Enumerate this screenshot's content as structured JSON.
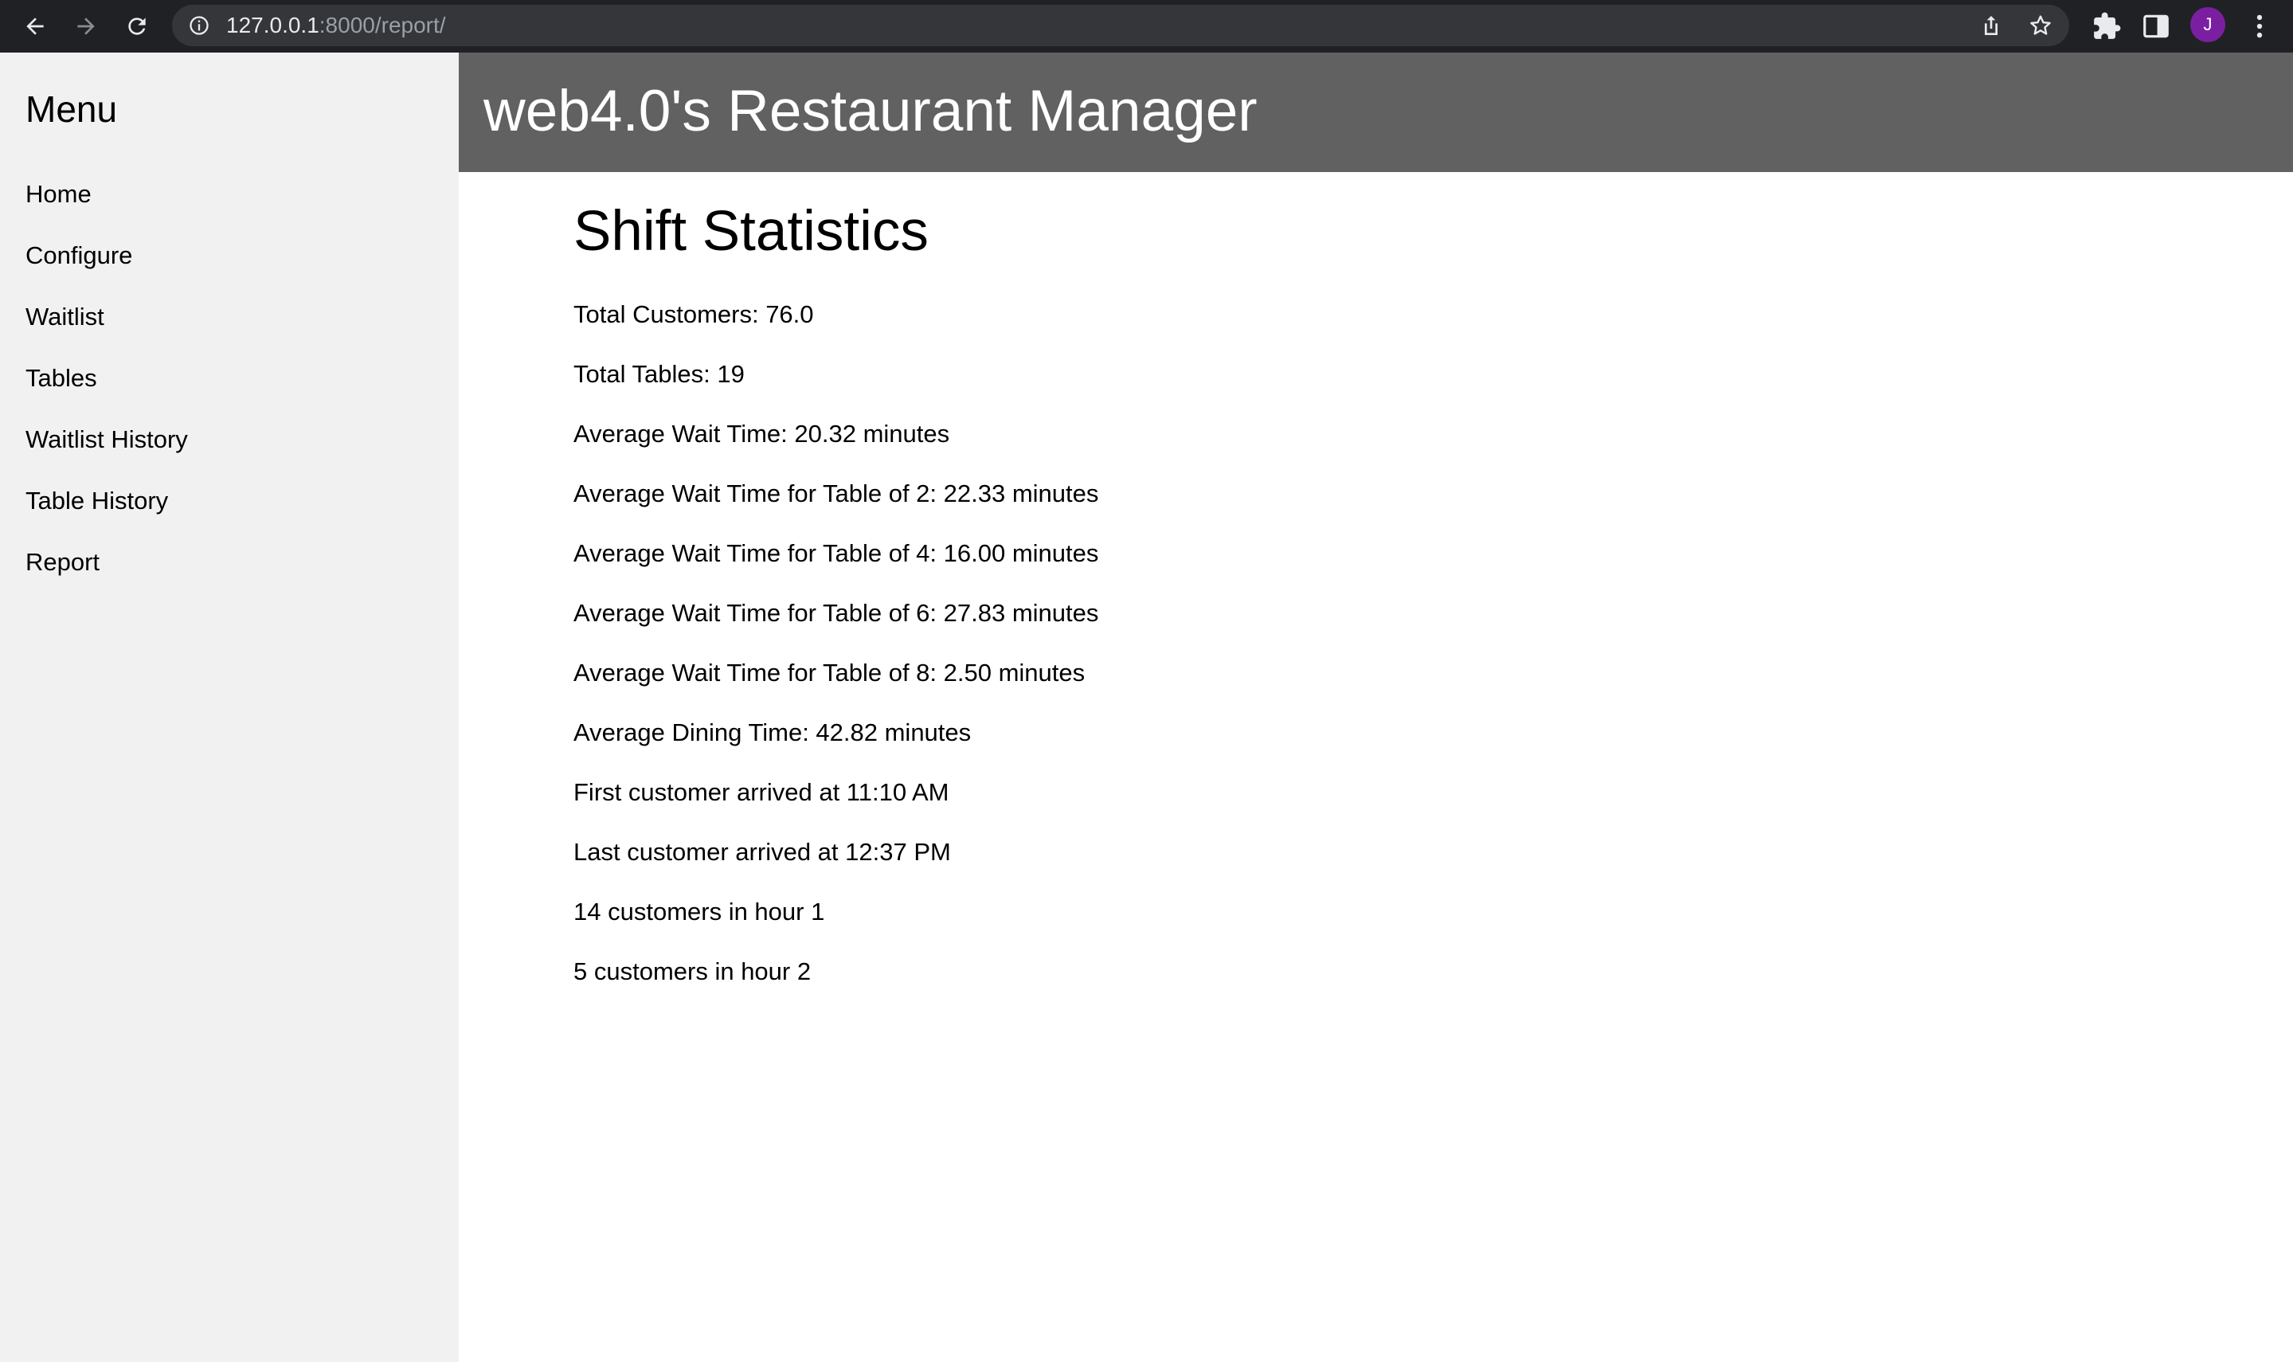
{
  "browser": {
    "url_host": "127.0.0.1",
    "url_rest": ":8000/report/",
    "avatar_letter": "J",
    "colors": {
      "toolbar": "#202124",
      "omnibox": "#35363a",
      "avatar": "#7b1fa2"
    },
    "icons": [
      "back-icon",
      "forward-icon",
      "reload-icon",
      "info-icon",
      "share-icon",
      "star-icon",
      "extensions-icon",
      "side-panel-icon",
      "kebab-menu-icon"
    ]
  },
  "sidebar": {
    "title": "Menu",
    "items": [
      {
        "label": "Home"
      },
      {
        "label": "Configure"
      },
      {
        "label": "Waitlist"
      },
      {
        "label": "Tables"
      },
      {
        "label": "Waitlist History"
      },
      {
        "label": "Table History"
      },
      {
        "label": "Report"
      }
    ]
  },
  "header": {
    "title": "web4.0's Restaurant Manager"
  },
  "main": {
    "title": "Shift Statistics",
    "stats": [
      "Total Customers: 76.0",
      "Total Tables: 19",
      "Average Wait Time: 20.32 minutes",
      "Average Wait Time for Table of 2: 22.33 minutes",
      "Average Wait Time for Table of 4: 16.00 minutes",
      "Average Wait Time for Table of 6: 27.83 minutes",
      "Average Wait Time for Table of 8: 2.50 minutes",
      "Average Dining Time: 42.82 minutes",
      "First customer arrived at 11:10 AM",
      "Last customer arrived at 12:37 PM",
      "14 customers in hour 1",
      "5 customers in hour 2"
    ]
  },
  "colors": {
    "sidebar_bg": "#f1f1f1",
    "header_bg": "#616161",
    "header_text": "#ffffff"
  }
}
